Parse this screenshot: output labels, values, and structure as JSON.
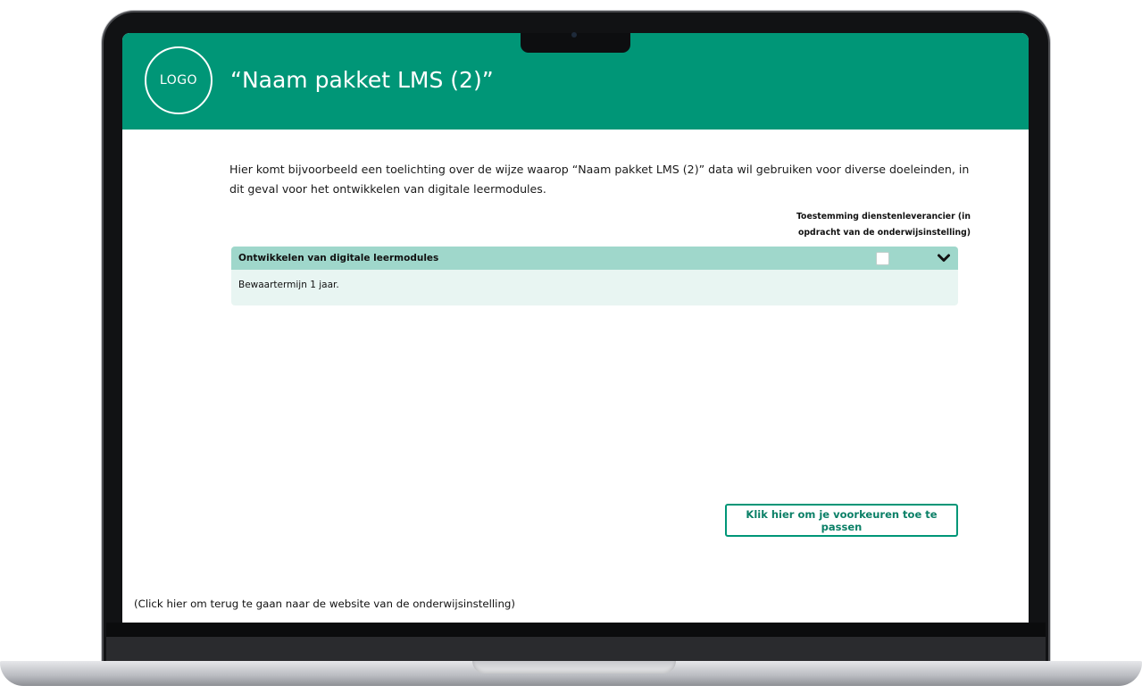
{
  "header": {
    "logo_text": "LOGO",
    "title": "“Naam pakket LMS (2)”"
  },
  "intro": {
    "text": "Hier komt bijvoorbeeld een toelichting over de wijze waarop “Naam pakket LMS (2)” data wil gebruiken voor diverse doeleinden, in dit geval voor het ontwikkelen van digitale leermodules."
  },
  "consent_column": {
    "label": "Toestemming dienstenleverancier (in opdracht van de onderwijsinstelling)"
  },
  "purposes": [
    {
      "title": "Ontwikkelen van digitale leermodules",
      "detail": "Bewaartermijn 1 jaar.",
      "checked": false,
      "expanded": true
    }
  ],
  "actions": {
    "apply_label": "Klik hier om je voorkeuren toe te passen",
    "back_label": "(Click hier om terug te gaan naar de website van de onderwijsinstelling)"
  },
  "colors": {
    "header_bg": "#009677",
    "accordion_header_bg": "#9fd7cb",
    "accordion_body_bg": "#e8f5f2",
    "button_accent": "#009677"
  }
}
